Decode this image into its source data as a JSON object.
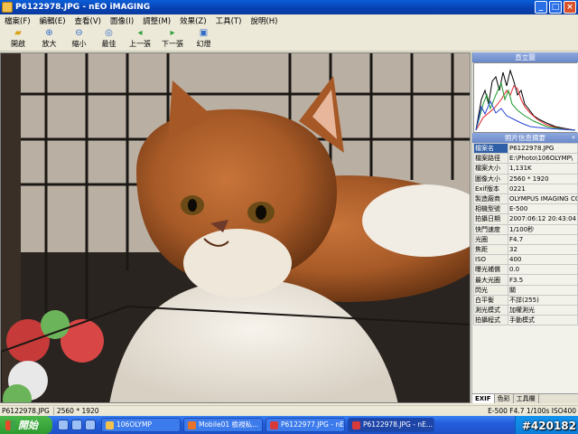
{
  "window": {
    "title": "P6122978.JPG - nEO iMAGING",
    "buttons": {
      "minimize": "_",
      "maximize": "□",
      "close": "×"
    }
  },
  "menu": [
    "檔案(F)",
    "編輯(E)",
    "查看(V)",
    "圖像(I)",
    "調整(M)",
    "效果(Z)",
    "工具(T)",
    "說明(H)"
  ],
  "toolbar": [
    {
      "label": "開啟",
      "icon": "open-folder-icon"
    },
    {
      "label": "放大",
      "icon": "zoom-in-icon"
    },
    {
      "label": "縮小",
      "icon": "zoom-out-icon"
    },
    {
      "label": "最佳",
      "icon": "best-fit-icon"
    },
    {
      "label": "上一張",
      "icon": "previous-icon"
    },
    {
      "label": "下一張",
      "icon": "next-icon"
    },
    {
      "label": "幻燈",
      "icon": "slideshow-icon"
    }
  ],
  "panel": {
    "histogram_title": "直立圖",
    "info_title": "照片信息摘要",
    "exif": [
      {
        "key": "檔案名",
        "value": "P6122978.JPG"
      },
      {
        "key": "檔案路徑",
        "value": "E:\\Photo\\106OLYMP\\"
      },
      {
        "key": "檔案大小",
        "value": "1,131K"
      },
      {
        "key": "圖像大小",
        "value": "2560 * 1920"
      },
      {
        "key": "Exif版本",
        "value": "0221"
      },
      {
        "key": "製造廠商",
        "value": "OLYMPUS IMAGING CO"
      },
      {
        "key": "相機型號",
        "value": "E-500"
      },
      {
        "key": "拍攝日期",
        "value": "2007:06:12 20:43:04"
      },
      {
        "key": "快門速度",
        "value": "1/100秒"
      },
      {
        "key": "光圈",
        "value": "F4.7"
      },
      {
        "key": "焦距",
        "value": "32"
      },
      {
        "key": "ISO",
        "value": "400"
      },
      {
        "key": "曝光補償",
        "value": "0.0"
      },
      {
        "key": "最大光圈",
        "value": "F3.5"
      },
      {
        "key": "閃光",
        "value": "關"
      },
      {
        "key": "白平衡",
        "value": "不詳(255)"
      },
      {
        "key": "測光模式",
        "value": "加權測光"
      },
      {
        "key": "拍攝程式",
        "value": "手動模式"
      }
    ],
    "tabs": [
      "EXIF",
      "色彩",
      "工具欄"
    ]
  },
  "status": {
    "filename": "P6122978.JPG",
    "size": "2560 * 1920",
    "camera_info": "E-500 F4.7 1/100s ISO400"
  },
  "taskbar": {
    "start_label": "開始",
    "tasks": [
      {
        "label": "106OLYMP",
        "active": false
      },
      {
        "label": "Mobile01 檢視私...",
        "active": false
      },
      {
        "label": "P6122977.JPG - nE...",
        "active": false
      },
      {
        "label": "P6122978.JPG - nE...",
        "active": true
      }
    ],
    "watermark": "#420182"
  }
}
